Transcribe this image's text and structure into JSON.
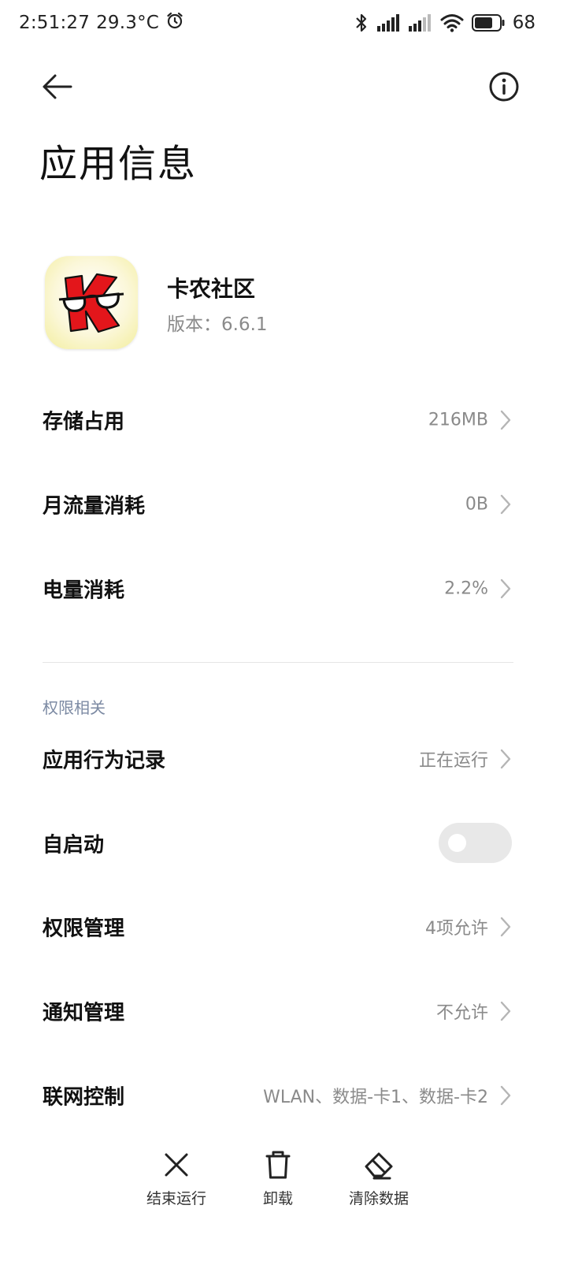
{
  "status_bar": {
    "time": "2:51:27",
    "temperature": "29.3°C",
    "battery": "68"
  },
  "header": {
    "title": "应用信息"
  },
  "app": {
    "name": "卡农社区",
    "version_label": "版本：",
    "version": "6.6.1"
  },
  "usage_rows": [
    {
      "label": "存储占用",
      "value": "216MB"
    },
    {
      "label": "月流量消耗",
      "value": "0B"
    },
    {
      "label": "电量消耗",
      "value": "2.2%"
    }
  ],
  "permissions": {
    "section_title": "权限相关",
    "rows": [
      {
        "label": "应用行为记录",
        "value": "正在运行"
      },
      {
        "label": "自启动",
        "value": "",
        "toggle_on": false
      },
      {
        "label": "权限管理",
        "value": "4项允许"
      },
      {
        "label": "通知管理",
        "value": "不允许"
      },
      {
        "label": "联网控制",
        "value": "WLAN、数据-卡1、数据-卡2"
      }
    ]
  },
  "actions": [
    {
      "label": "结束运行",
      "icon": "close-icon"
    },
    {
      "label": "卸载",
      "icon": "trash-icon"
    },
    {
      "label": "清除数据",
      "icon": "eraser-icon"
    }
  ],
  "colors": {
    "text_primary": "#111111",
    "text_secondary": "#8a8a8a",
    "section_header": "#7c8aa3",
    "toggle_off": "#e8e8e8",
    "icon_red": "#e3161b"
  }
}
